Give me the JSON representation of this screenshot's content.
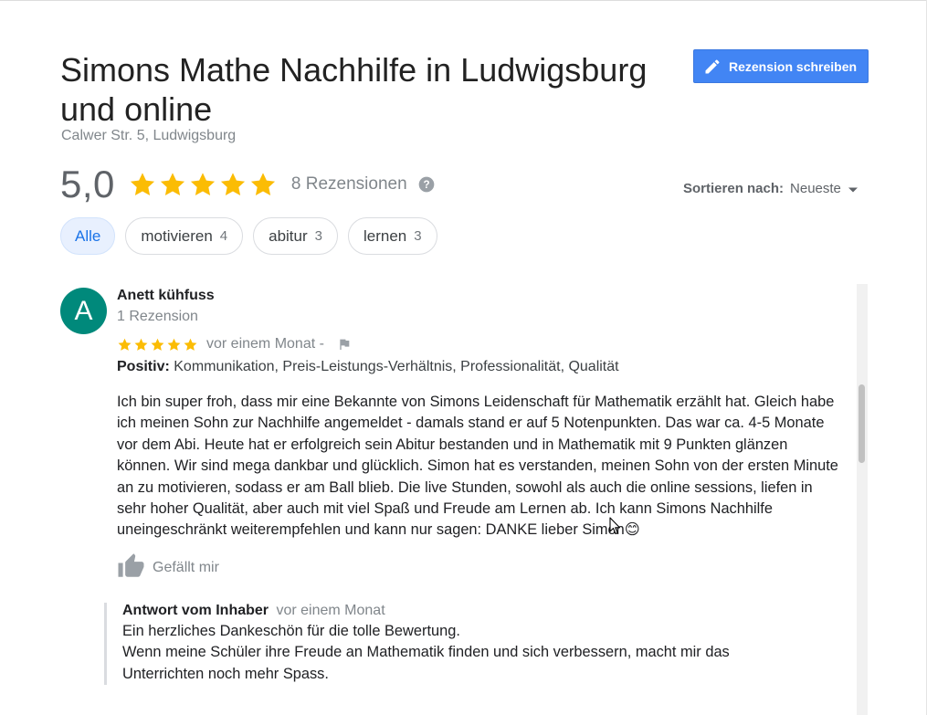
{
  "header": {
    "title": "Simons Mathe Nachhilfe in Ludwigsburg und online",
    "address": "Calwer Str. 5, Ludwigsburg",
    "write_review_label": "Rezension schreiben",
    "write_review_icon": "pencil-icon"
  },
  "summary": {
    "score": "5,0",
    "stars": 5,
    "review_count": "8 Rezensionen",
    "help_icon": "help-icon",
    "star_color": "#fbbc04"
  },
  "sort": {
    "label": "Sortieren nach:",
    "value": "Neueste"
  },
  "chips": [
    {
      "label": "Alle",
      "count": "",
      "active": true
    },
    {
      "label": "motivieren",
      "count": "4",
      "active": false
    },
    {
      "label": "abitur",
      "count": "3",
      "active": false
    },
    {
      "label": "lernen",
      "count": "3",
      "active": false
    }
  ],
  "review": {
    "avatar_letter": "A",
    "avatar_color": "#00897b",
    "author": "Anett kühfuss",
    "author_meta": "1 Rezension",
    "stars": 5,
    "when": "vor einem Monat -",
    "positive_label": "Positiv:",
    "positive_items": "Kommunikation, Preis-Leistungs-Verhältnis, Professionalität, Qualität",
    "text": "Ich bin super froh, dass mir eine Bekannte von Simons Leidenschaft für Mathematik erzählt hat. Gleich habe ich meinen Sohn zur Nachhilfe angemeldet - damals stand er auf 5 Notenpunkten. Das war ca. 4-5 Monate vor dem Abi. Heute hat er erfolgreich sein Abitur bestanden und in Mathematik mit 9 Punkten glänzen können. Wir sind mega dankbar und glücklich. Simon hat es verstanden, meinen Sohn von der ersten Minute an zu motivieren, sodass er am Ball blieb. Die live Stunden, sowohl als auch die online sessions, liefen in sehr hoher Qualität, aber auch mit viel Spaß und Freude am Lernen ab. Ich kann Simons Nachhilfe uneingeschränkt weiterempfehlen und kann nur sagen: DANKE lieber Simon😊",
    "like_label": "Gefällt mir"
  },
  "reply": {
    "title": "Antwort vom Inhaber",
    "when": "vor einem Monat",
    "line1": "Ein herzliches Dankeschön für die tolle Bewertung.",
    "line2": "Wenn meine Schüler ihre Freude an Mathematik finden und sich verbessern, macht mir das Unterrichten noch mehr Spass."
  },
  "colors": {
    "accent": "#4285f4",
    "chip_active_bg": "#e8f0fe",
    "chip_active_text": "#1a73e8"
  }
}
